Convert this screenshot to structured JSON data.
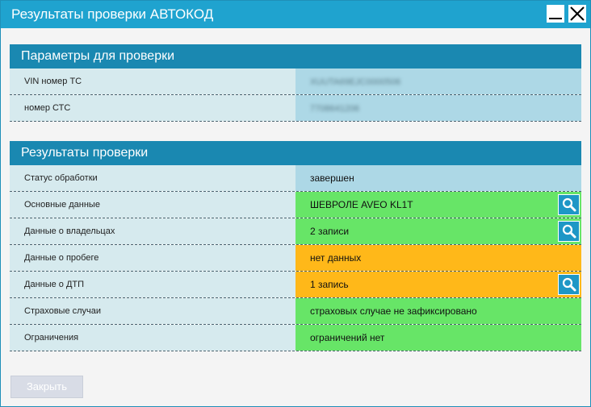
{
  "window": {
    "title": "Результаты проверки АВТОКОД"
  },
  "params_section": {
    "header": "Параметры для проверки",
    "rows": [
      {
        "label": "VIN номер ТС",
        "value": "XUUTA69EJC0000506"
      },
      {
        "label": "номер СТС",
        "value": "7708641206"
      }
    ]
  },
  "results_section": {
    "header": "Результаты проверки",
    "rows": [
      {
        "label": "Статус обработки",
        "value": "завершен",
        "status": "neutral"
      },
      {
        "label": "Основные данные",
        "value": "ШЕВРОЛЕ AVEO KL1T",
        "status": "ok",
        "has_details": true
      },
      {
        "label": "Данные о владельцах",
        "value": "2 записи",
        "status": "ok",
        "has_details": true
      },
      {
        "label": "Данные о пробеге",
        "value": "нет данных",
        "status": "warning"
      },
      {
        "label": "Данные о ДТП",
        "value": "1 запись",
        "status": "warning",
        "has_details": true
      },
      {
        "label": "Страховые случаи",
        "value": "страховых случае не зафиксировано",
        "status": "ok"
      },
      {
        "label": "Ограничения",
        "value": "ограничений нет",
        "status": "ok"
      }
    ]
  },
  "footer": {
    "close_label": "Закрыть"
  },
  "icons": {
    "minimize": "minimize-icon",
    "close": "close-icon",
    "details": "search-icon"
  },
  "colors": {
    "titlebar": "#1fa3cf",
    "section_header": "#1a88b1",
    "label_bg": "#d6eaee",
    "neutral": "#add8e6",
    "ok": "#67e567",
    "warning": "#ffb819"
  }
}
